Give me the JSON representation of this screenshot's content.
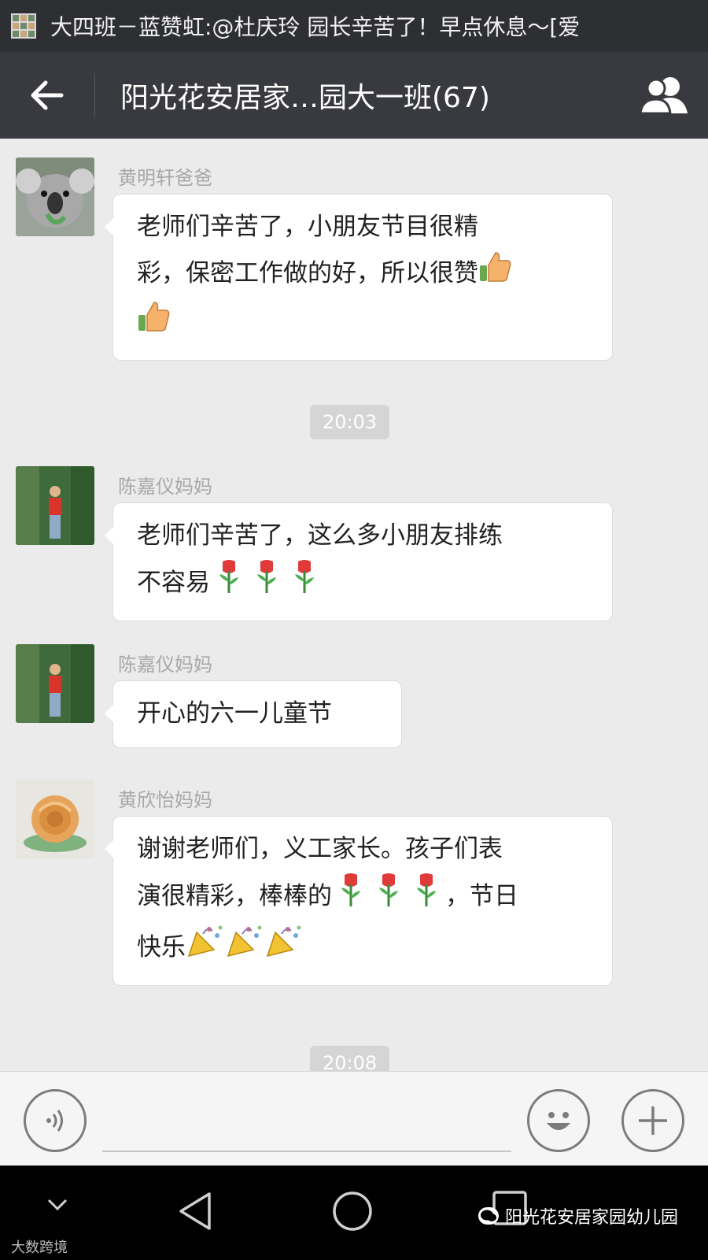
{
  "notification": {
    "text": "大四班－蓝赞虹:@杜庆玲 园长辛苦了！早点休息～[爱"
  },
  "header": {
    "title": "阳光花安居家…园大一班(67)"
  },
  "messages": [
    {
      "sender": "黄明轩爸爸",
      "lines": [
        "老师们辛苦了，小朋友节目很精",
        "彩，保密工作做的好，所以很赞"
      ],
      "emoji": [
        "thumbs-up-icon",
        "thumbs-up-icon"
      ]
    },
    {
      "time": "20:03"
    },
    {
      "sender": "陈嘉仪妈妈",
      "lines": [
        "老师们辛苦了，这么多小朋友排练",
        "不容易"
      ],
      "emoji": [
        "rose-icon",
        "rose-icon",
        "rose-icon"
      ]
    },
    {
      "sender": "陈嘉仪妈妈",
      "lines": [
        "开心的六一儿童节"
      ]
    },
    {
      "sender": "黄欣怡妈妈",
      "lines": [
        "谢谢老师们，义工家长。孩子们表",
        "演很精彩，棒棒的",
        "，节日",
        "快乐"
      ],
      "emoji": [
        "rose-icon",
        "rose-icon",
        "rose-icon",
        "party-popper-icon",
        "party-popper-icon",
        "party-popper-icon"
      ]
    },
    {
      "time": "20:08"
    }
  ],
  "watermark": {
    "brand": "阳光花安居家园幼儿园",
    "corner": "大数跨境"
  },
  "colors": {
    "header_bg": "#393a3f",
    "chat_bg": "#ebebeb",
    "bubble_bg": "#ffffff",
    "timestamp_bg": "#d5d5d5"
  }
}
